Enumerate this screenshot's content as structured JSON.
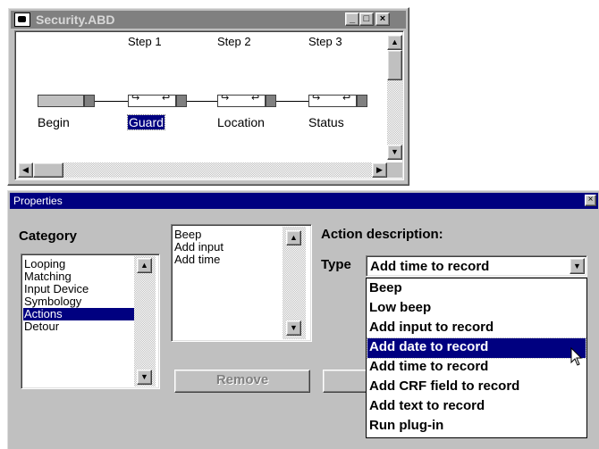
{
  "top_window": {
    "title": "Security.ABD",
    "caption_buttons": {
      "minimize": "_",
      "maximize": "□",
      "close": "×"
    },
    "steps": [
      "Step 1",
      "Step 2",
      "Step 3"
    ],
    "nodes": [
      {
        "label": "Begin",
        "selected": false
      },
      {
        "label": "Guard",
        "selected": true
      },
      {
        "label": "Location",
        "selected": false
      },
      {
        "label": "Status",
        "selected": false
      }
    ],
    "node_arrows": {
      "in": "↪",
      "out": "↩"
    }
  },
  "properties": {
    "title": "Properties",
    "close_glyph": "×",
    "category": {
      "heading": "Category",
      "items": [
        "Looping",
        "Matching",
        "Input Device",
        "Symbology",
        "Actions",
        "Detour"
      ],
      "selected": "Actions"
    },
    "actions_list": {
      "items": [
        "Beep",
        "Add input",
        "Add time"
      ]
    },
    "remove_button": "Remove",
    "action_description": {
      "heading": "Action description:",
      "type_label": "Type",
      "type_value": "Add time to record",
      "options": [
        "Beep",
        "Low beep",
        "Add input to record",
        "Add date to record",
        "Add time to record",
        "Add CRF field to record",
        "Add text to record",
        "Run plug-in"
      ],
      "highlighted": "Add date to record"
    }
  },
  "colors": {
    "face": "#c0c0c0",
    "active_title": "#000080",
    "inactive_title": "#808080",
    "selection": "#000080"
  }
}
